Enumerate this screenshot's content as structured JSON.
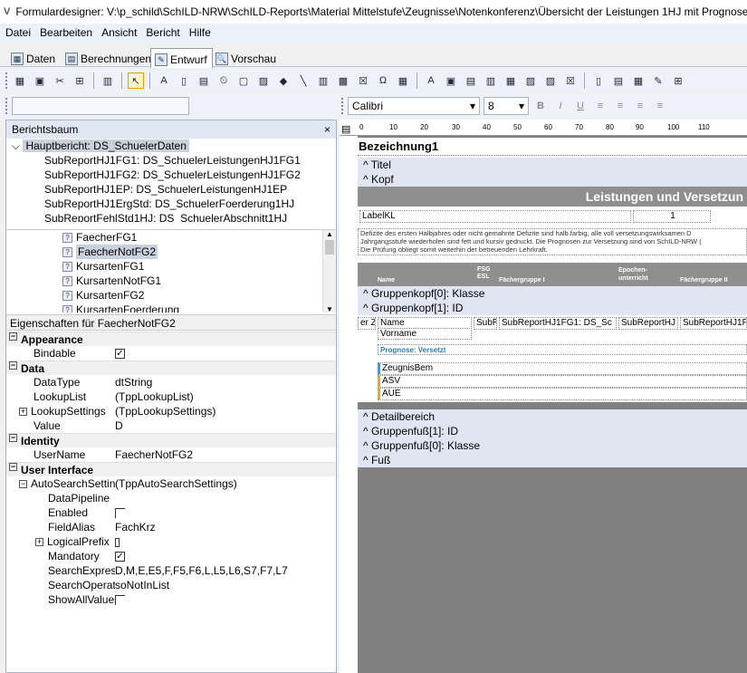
{
  "window": {
    "title": "Formulardesigner: V:\\p_schild\\SchILD-NRW\\SchILD-Reports\\Material Mittelstufe\\Zeugnisse\\Notenkonferenz\\Übersicht der Leistungen 1HJ mit Prognose"
  },
  "menu": [
    "Datei",
    "Bearbeiten",
    "Ansicht",
    "Bericht",
    "Hilfe"
  ],
  "view_tabs": [
    "Daten",
    "Berechnungen",
    "Entwurf",
    "Vorschau"
  ],
  "font": {
    "name": "Calibri",
    "size": "8"
  },
  "report_tree": {
    "title": "Berichtsbaum",
    "close": "×",
    "root": "Hauptbericht: DS_SchuelerDaten",
    "children": [
      "SubReportHJ1FG1: DS_SchuelerLeistungenHJ1FG1",
      "SubReportHJ1FG2: DS_SchuelerLeistungenHJ1FG2",
      "SubReportHJ1EP: DS_SchuelerLeistungenHJ1EP",
      "SubReportHJ1ErgStd: DS_SchuelerFoerderung1HJ",
      "SubReportFehlStd1HJ: DS_SchuelerAbschnitt1HJ"
    ]
  },
  "fields": [
    "FaecherFG1",
    "FaecherNotFG2",
    "KursartenFG1",
    "KursartenNotFG1",
    "KursartenFG2",
    "KursartenFoerderung"
  ],
  "properties": {
    "title": "Eigenschaften für FaecherNotFG2",
    "appearance": {
      "label": "Appearance",
      "bindable": "Bindable"
    },
    "data": {
      "label": "Data",
      "datatype_name": "DataType",
      "datatype_val": "dtString",
      "lookuplist_name": "LookupList",
      "lookuplist_val": "(TppLookupList)",
      "lookupsettings_name": "LookupSettings",
      "lookupsettings_val": "(TppLookupSettings)",
      "value_name": "Value",
      "value_val": "D"
    },
    "identity": {
      "label": "Identity",
      "username_name": "UserName",
      "username_val": "FaecherNotFG2"
    },
    "ui": {
      "label": "User Interface",
      "autosearch_name": "AutoSearchSettings",
      "autosearch_val": "(TppAutoSearchSettings)",
      "datapipeline": "DataPipeline",
      "enabled": "Enabled",
      "fieldalias_name": "FieldAlias",
      "fieldalias_val": "FachKrz",
      "logicalprefix": "LogicalPrefix",
      "mandatory": "Mandatory",
      "searchexpr_name": "SearchExpression",
      "searchexpr_val": "D,M,E,E5,F,F5,F6,L,L5,L6,S7,F7,L7",
      "searchop_name": "SearchOperator",
      "searchop_val": "soNotInList",
      "showall": "ShowAllValues"
    }
  },
  "designer": {
    "ruler_ticks": [
      "0",
      "10",
      "20",
      "30",
      "40",
      "50",
      "60",
      "70",
      "80",
      "90",
      "100",
      "110"
    ],
    "bezeichnung": "Bezeichnung1",
    "titel": "Titel",
    "kopf": "Kopf",
    "header_text": "Leistungen und Versetzun",
    "labelkl": "LabelKL",
    "labelkl_right": "1",
    "note1": "Defizite des ersten Halbjahres oder nicht gemahnte Defizite sind halb.farbig, alle voll versetzungswirksamen D",
    "note2": "Jahrgangsstufe wiederholen sind fett und kursiv gedruckt. Die Prognosen zur Versetzung sind von SchILD-NRW (",
    "note3": "Die Prüfung obliegt somit weiterhin der betreuenden Lehrkraft.",
    "col_name": "Name",
    "col_fsg": "FSG ESL",
    "col_fg1": "Fächergruppe I",
    "col_epochen": "Epochen-unterricht",
    "col_fg2": "Fächergruppe II",
    "gk0": "Gruppenkopf[0]: Klasse",
    "gk1": "Gruppenkopf[1]: ID",
    "d_name": "Name",
    "d_vorname": "Vorname",
    "d_prefix": "er Z",
    "d_subr": "SubR",
    "d_sub1": "SubReportHJ1FG1: DS_Sc",
    "d_sub2": "SubReportHJ",
    "d_sub3": "SubReportHJ1F",
    "d_prognose": "Prognose: Versetzt",
    "d_zeugnis": "ZeugnisBem",
    "d_asv": "ASV",
    "d_aue": "AUE",
    "detail": "Detailbereich",
    "gf1": "Gruppenfuß[1]: ID",
    "gf0": "Gruppenfuß[0]: Klasse",
    "fuss": "Fuß"
  }
}
